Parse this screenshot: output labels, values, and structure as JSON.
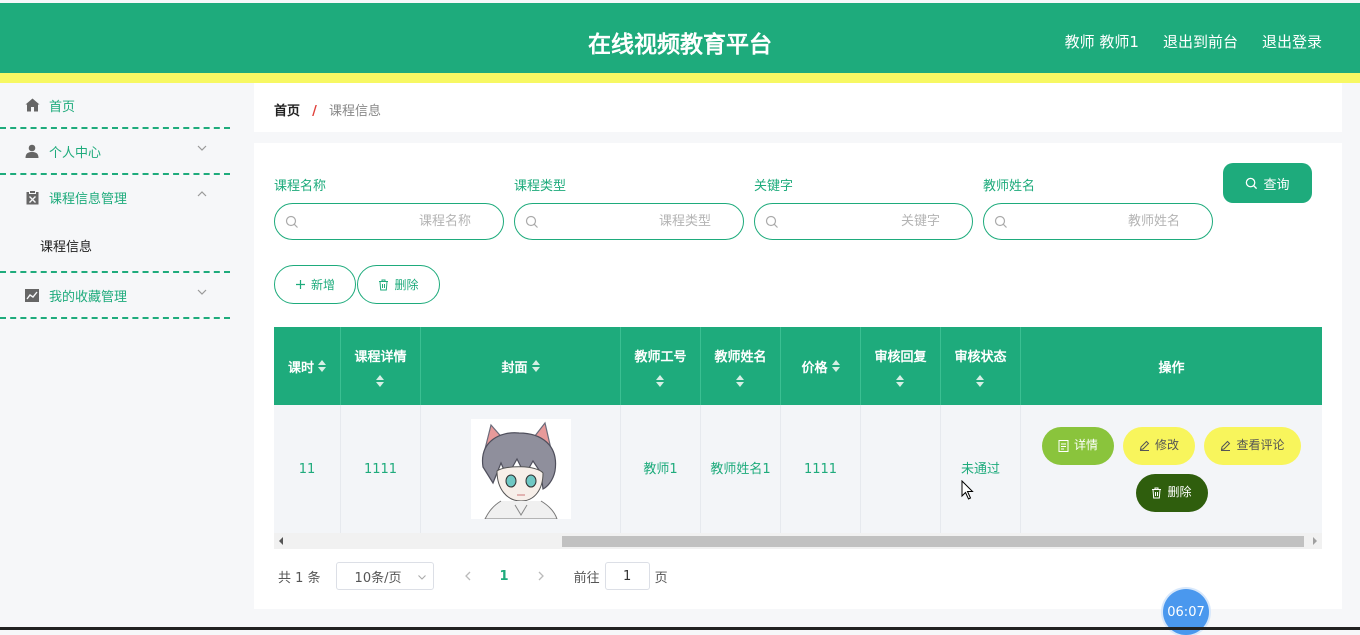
{
  "header": {
    "title": "在线视频教育平台",
    "user": "教师 教师1",
    "back_to_front": "退出到前台",
    "logout": "退出登录"
  },
  "sidebar": {
    "items": [
      {
        "label": "首页",
        "icon": "home-icon"
      },
      {
        "label": "个人中心",
        "icon": "user-icon"
      },
      {
        "label": "课程信息管理",
        "icon": "clipboard-icon"
      },
      {
        "label": "我的收藏管理",
        "icon": "chart-icon"
      }
    ],
    "sub_item": "课程信息"
  },
  "breadcrumb": {
    "home": "首页",
    "separator": "/",
    "current": "课程信息"
  },
  "filters": [
    {
      "label": "课程名称",
      "placeholder": "课程名称"
    },
    {
      "label": "课程类型",
      "placeholder": "课程类型"
    },
    {
      "label": "关键字",
      "placeholder": "关键字"
    },
    {
      "label": "教师姓名",
      "placeholder": "教师姓名"
    }
  ],
  "buttons": {
    "query": "查询",
    "add": "新增",
    "delete": "删除"
  },
  "table": {
    "columns": [
      "课时",
      "课程详情",
      "封面",
      "教师工号",
      "教师姓名",
      "价格",
      "审核回复",
      "审核状态",
      "操作"
    ],
    "rows": [
      {
        "hours": "11",
        "detail": "1111",
        "teacher_id": "教师1",
        "teacher_name": "教师姓名1",
        "price": "1111",
        "review_reply": "",
        "review_status": "未通过",
        "actions": {
          "detail": "详情",
          "edit": "修改",
          "comments": "查看评论",
          "delete": "删除"
        }
      }
    ]
  },
  "pagination": {
    "total": "共 1 条",
    "page_size": "10条/页",
    "current_page": "1",
    "goto_label": "前往",
    "goto_value": "1",
    "page_suffix": "页"
  },
  "clock": "06:07",
  "colors": {
    "primary": "#1eab7c",
    "stripe": "#f7f863",
    "detail_btn": "#8ac43c",
    "edit_btn": "#f8f55c",
    "delete_btn": "#2f5e0d"
  }
}
